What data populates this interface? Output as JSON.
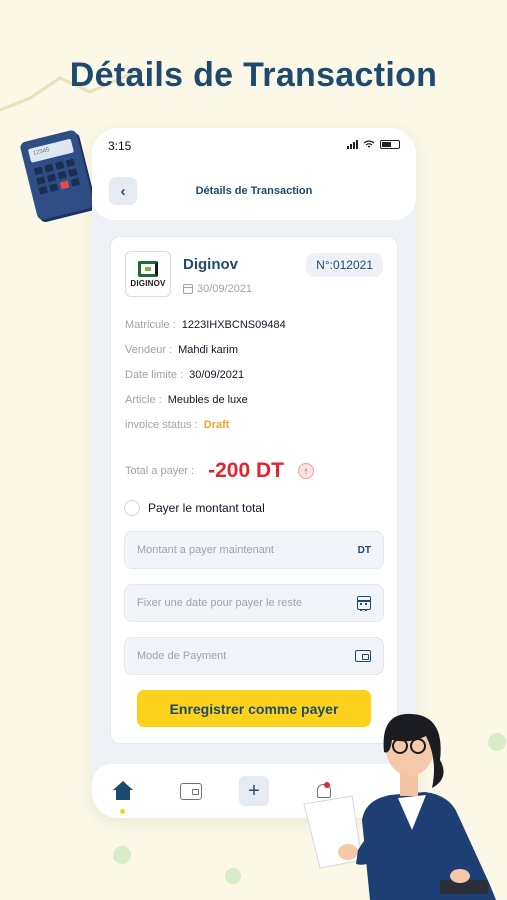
{
  "headline": "Détails de Transaction",
  "status_bar": {
    "time": "3:15"
  },
  "nav": {
    "title": "Détails de Transaction",
    "back_icon": "chevron-left-icon"
  },
  "invoice": {
    "company": "Diginov",
    "logo_text": "DIGINOV",
    "date": "30/09/2021",
    "number": "N°:012021",
    "details": [
      {
        "label": "Matricule :",
        "value": "1223IHXBCNS09484"
      },
      {
        "label": "Vendeur :",
        "value": "Mahdi karim"
      },
      {
        "label": "Date limite :",
        "value": "30/09/2021"
      },
      {
        "label": "Article :",
        "value": "Meubles de luxe"
      },
      {
        "label": "invoice status :",
        "value": "Draft"
      }
    ],
    "total_label": "Total a payer :",
    "total_value": "-200 DT"
  },
  "form": {
    "pay_full_label": "Payer le montant total",
    "amount_placeholder": "Montant a payer maintenant",
    "amount_suffix": "DT",
    "date_placeholder": "Fixer une date pour payer le reste",
    "payment_mode_placeholder": "Mode de Payment",
    "save_label": "Enregistrer comme payer"
  },
  "colors": {
    "primary": "#1d4a6e",
    "accent": "#fcd21c",
    "danger": "#e0262e",
    "draft": "#f0a626"
  }
}
